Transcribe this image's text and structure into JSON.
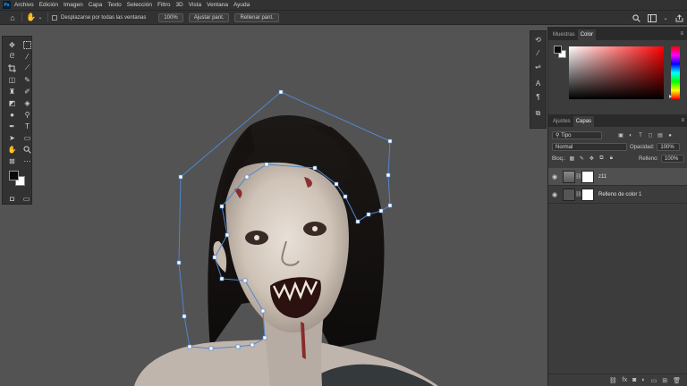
{
  "menubar": {
    "logo": "Ps",
    "items": [
      "Archivo",
      "Edición",
      "Imagen",
      "Capa",
      "Texto",
      "Selección",
      "Filtro",
      "3D",
      "Vista",
      "Ventana",
      "Ayuda"
    ]
  },
  "options": {
    "scroll_all_label": "Desplazarse por todas las ventanas",
    "zoom_value": "100%",
    "fit_label": "Ajustar pant.",
    "fill_label": "Rellenar pant."
  },
  "color_panel": {
    "tabs": [
      "Muestras",
      "Color"
    ],
    "active_tab": "Color",
    "foreground": "#0a0a0a",
    "background": "#ffffff",
    "hue": "#ff0000"
  },
  "layers_panel": {
    "tabs": [
      "Ajustes",
      "Capas"
    ],
    "active_tab": "Capas",
    "filter_label": "Tipo",
    "blend_mode": "Normal",
    "opacity_label": "Opacidad:",
    "opacity_value": "100%",
    "lock_label": "Bloq.:",
    "fill_label": "Relleno:",
    "fill_value": "100%",
    "layers": [
      {
        "name": "z11",
        "selected": true
      },
      {
        "name": "Relleno de color 1",
        "selected": false
      }
    ]
  },
  "accent": "#5b8fd6"
}
